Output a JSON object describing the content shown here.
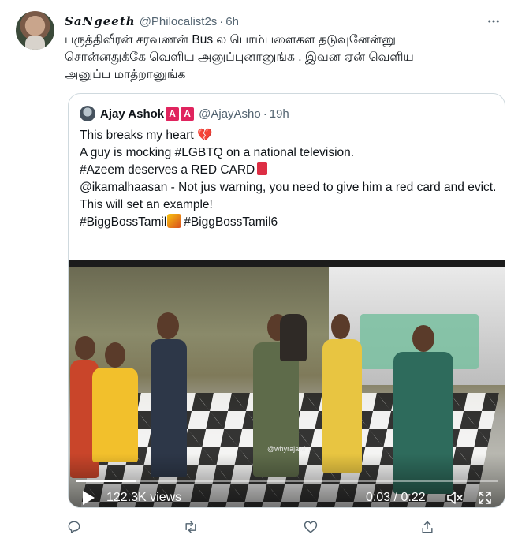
{
  "tweet": {
    "display_name": "SaNgeeth",
    "handle": "@Philocalist2s",
    "separator": "·",
    "time": "6h",
    "text_lines": [
      "பருத்திவீரன் சரவணன் Bus ல பொம்பளைகள தடுவுனேன்னு",
      "சொன்னதுக்கே வெளிய அனுப்புனானுங்க . இவன ஏன் வெளிய",
      "அனுப்ப மாத்றானுங்க"
    ]
  },
  "quote": {
    "display_name": "Ajay Ashok",
    "badges": [
      "A",
      "A"
    ],
    "handle": "@AjayAsho",
    "separator": "·",
    "time": "19h",
    "line1": "This breaks my heart",
    "line1_emoji": "💔",
    "line2": "A guy is mocking #LGBTQ on a national television.",
    "line3": "#Azeem deserves a RED CARD",
    "line4": "@ikamalhaasan - Not jus warning, you need to give him a red card and evict.",
    "line5": "This will set an example!",
    "line6_a": "#BiggBossTamil",
    "line6_b": "#BiggBossTamil6"
  },
  "video": {
    "watermark": "@whyrajawhy",
    "views": "122.3K views",
    "timer": "0:03 / 0:22",
    "progress_fraction": 0.14
  },
  "colors": {
    "text": "#0f1419",
    "secondary": "#536471",
    "border": "#cfd9de",
    "red": "#dd2e44"
  },
  "icons": {
    "more": "more-dots-icon",
    "reply": "reply-icon",
    "retweet": "retweet-icon",
    "like": "heart-icon",
    "share": "share-icon",
    "play": "play-icon",
    "mute": "mute-icon",
    "fullscreen": "fullscreen-icon"
  }
}
